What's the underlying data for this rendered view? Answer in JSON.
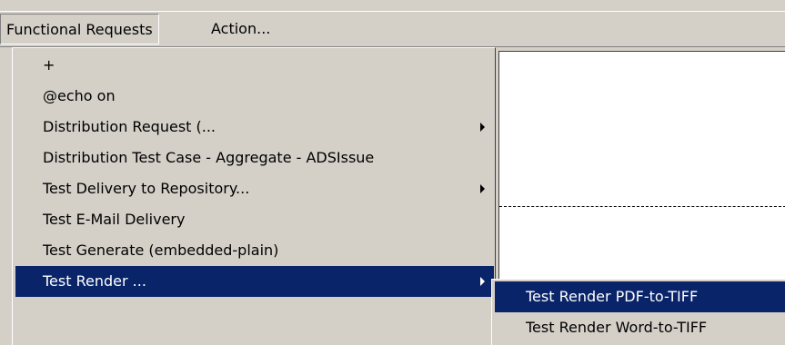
{
  "menubar": {
    "items": [
      {
        "label": "Functional Requests"
      },
      {
        "label": "Action..."
      }
    ]
  },
  "dropdown": {
    "items": [
      {
        "label": "+",
        "has_submenu": false
      },
      {
        "label": "@echo on",
        "has_submenu": false
      },
      {
        "label": "Distribution Request (...",
        "has_submenu": true
      },
      {
        "label": "Distribution Test Case - Aggregate - ADSIssue",
        "has_submenu": false
      },
      {
        "label": "Test Delivery to Repository...",
        "has_submenu": true
      },
      {
        "label": "Test E-Mail Delivery",
        "has_submenu": false
      },
      {
        "label": "Test Generate (embedded-plain)",
        "has_submenu": false
      },
      {
        "label": "Test Render ...",
        "has_submenu": true,
        "highlighted": true
      }
    ]
  },
  "submenu": {
    "items": [
      {
        "label": "Test Render PDF-to-TIFF",
        "highlighted": true
      },
      {
        "label": "Test Render Word-to-TIFF"
      }
    ]
  },
  "colors": {
    "menu_bg": "#d4d0c8",
    "highlight_bg": "#0a246a",
    "highlight_text": "#ffffff"
  }
}
